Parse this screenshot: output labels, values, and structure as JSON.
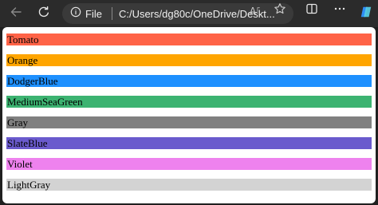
{
  "browser": {
    "site_label": "File",
    "url": "C:/Users/dg80c/OneDrive/Deskt...",
    "icons": [
      "back-arrow-icon",
      "refresh-icon",
      "info-icon",
      "read-aloud-icon",
      "favorite-star-icon",
      "split-screen-icon",
      "more-icon",
      "copilot-icon"
    ]
  },
  "bars": [
    {
      "label": "Tomato",
      "color": "#ff6347"
    },
    {
      "label": "Orange",
      "color": "#ffa500"
    },
    {
      "label": "DodgerBlue",
      "color": "#1e90ff"
    },
    {
      "label": "MediumSeaGreen",
      "color": "#3cb371"
    },
    {
      "label": "Gray",
      "color": "#808080"
    },
    {
      "label": "SlateBlue",
      "color": "#6a5acd"
    },
    {
      "label": "Violet",
      "color": "#ee82ee"
    },
    {
      "label": "LightGray",
      "color": "#d3d3d3"
    }
  ]
}
